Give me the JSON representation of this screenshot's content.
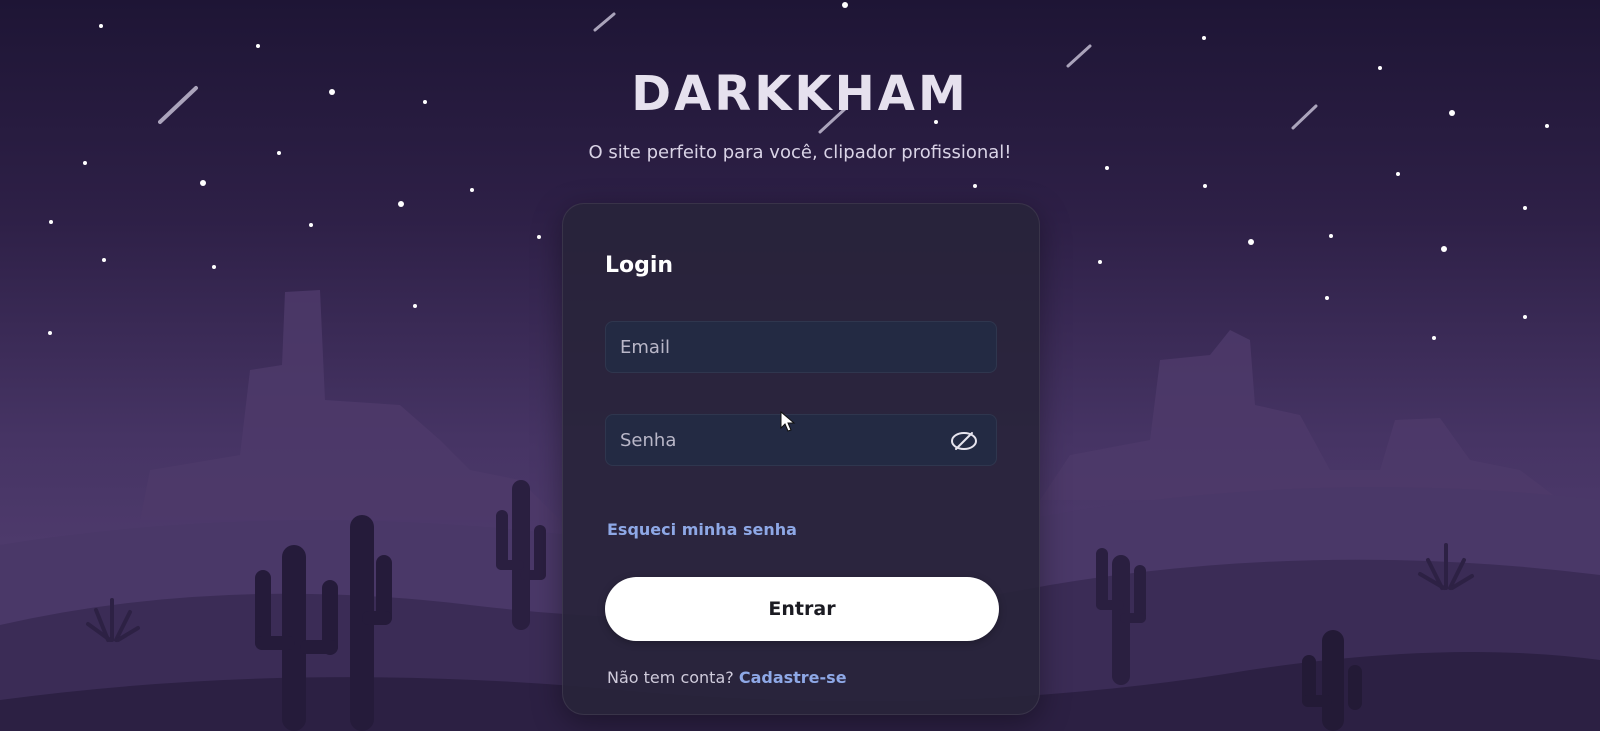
{
  "header": {
    "brand": "DARKKHAM",
    "tagline": "O site perfeito para você, clipador profissional!"
  },
  "login": {
    "title": "Login",
    "email": {
      "placeholder": "Email",
      "value": ""
    },
    "password": {
      "placeholder": "Senha",
      "value": "",
      "toggle_icon": "eye-off-icon"
    },
    "forgot_label": "Esqueci minha senha",
    "submit_label": "Entrar",
    "signup_prompt": "Não tem conta?",
    "signup_label": "Cadastre-se"
  },
  "colors": {
    "sky_top": "#1e1535",
    "sky_bottom": "#5a4478",
    "card_bg": "#28243a",
    "input_bg": "#232a43",
    "link": "#8ea8e6",
    "button_bg": "#ffffff"
  }
}
